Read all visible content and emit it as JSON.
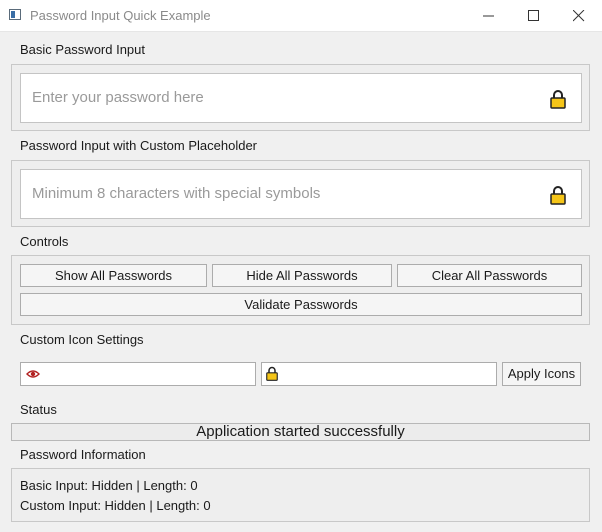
{
  "window": {
    "title": "Password Input Quick Example"
  },
  "basic": {
    "label": "Basic Password Input",
    "placeholder": "Enter your password here",
    "icon": "lock-icon"
  },
  "custom": {
    "label": "Password Input with Custom Placeholder",
    "placeholder": "Minimum 8 characters with special symbols",
    "icon": "lock-icon"
  },
  "controls": {
    "label": "Controls",
    "show_all": "Show All Passwords",
    "hide_all": "Hide All Passwords",
    "clear_all": "Clear All Passwords",
    "validate": "Validate Passwords"
  },
  "icon_settings": {
    "label": "Custom Icon Settings",
    "visible_icon": "eye-icon",
    "hidden_icon": "lock-icon",
    "apply": "Apply Icons"
  },
  "status": {
    "label": "Status",
    "message": "Application started successfully"
  },
  "info": {
    "label": "Password Information",
    "basic_line": "Basic Input: Hidden | Length: 0",
    "custom_line": "Custom Input: Hidden | Length: 0"
  },
  "colors": {
    "lock_fill": "#f5c518",
    "eye_color": "#b22222",
    "window_bg": "#f0f0f0"
  }
}
